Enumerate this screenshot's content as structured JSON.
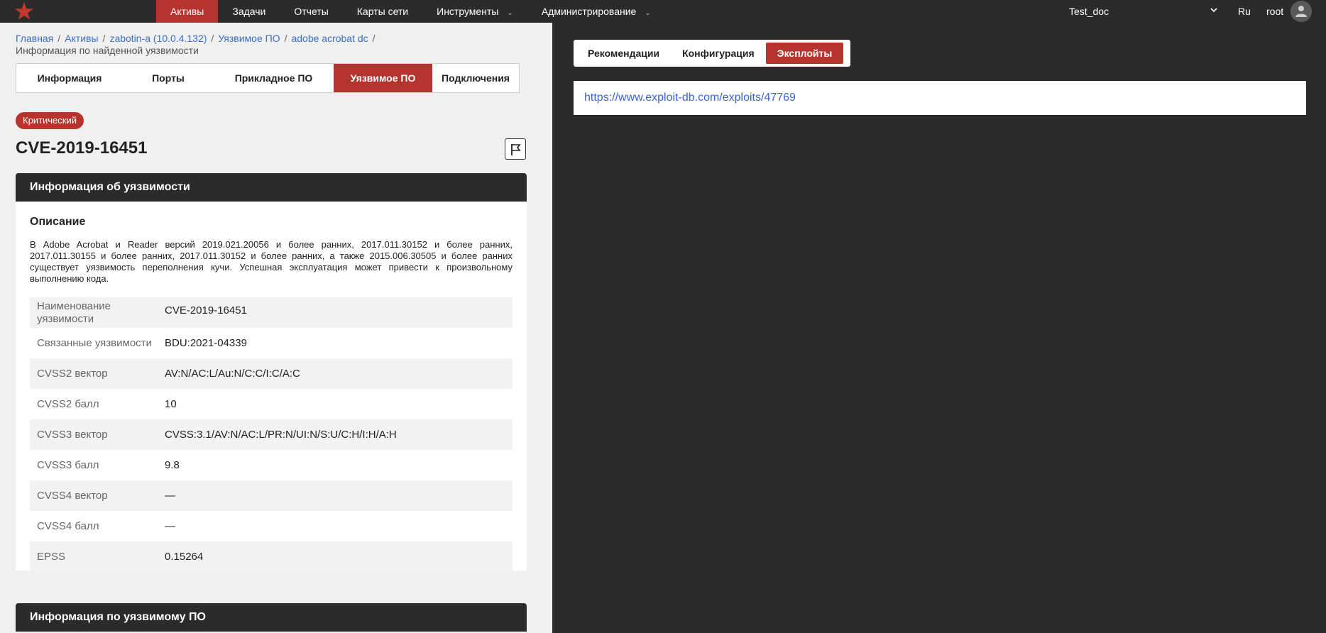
{
  "topbar": {
    "nav": [
      {
        "label": "Активы",
        "active": true,
        "dropdown": false
      },
      {
        "label": "Задачи",
        "active": false,
        "dropdown": false
      },
      {
        "label": "Отчеты",
        "active": false,
        "dropdown": false
      },
      {
        "label": "Карты сети",
        "active": false,
        "dropdown": false
      },
      {
        "label": "Инструменты",
        "active": false,
        "dropdown": true
      },
      {
        "label": "Администрирование",
        "active": false,
        "dropdown": true
      }
    ],
    "chevron": "⌄",
    "doc_select": "Test_doc",
    "lang": "Ru",
    "user": "root"
  },
  "breadcrumb": {
    "items": [
      "Главная",
      "Активы",
      "zabotin-a (10.0.4.132)",
      "Уязвимое ПО",
      "adobe acrobat dc"
    ],
    "separator": "/",
    "current": "Информация по найденной уязвимости"
  },
  "tabs": [
    {
      "label": "Информация",
      "active": false
    },
    {
      "label": "Порты",
      "active": false
    },
    {
      "label": "Прикладное ПО",
      "active": false
    },
    {
      "label": "Уязвимое ПО",
      "active": true
    },
    {
      "label": "Подключения",
      "active": false
    }
  ],
  "severity": "Критический",
  "cve_id": "CVE-2019-16451",
  "vuln_card": {
    "header": "Информация об уязвимости",
    "desc_title": "Описание",
    "description": "В Adobe Acrobat и Reader версий 2019.021.20056 и более ранних, 2017.011.30152 и более ранних, 2017.011.30155 и более ранних, 2017.011.30152 и более ранних, а также 2015.006.30505 и более ранних существует уязвимость переполнения кучи. Успешная эксплуатация может привести к произвольному выполнению кода.",
    "rows": [
      {
        "key": "Наименование уязвимости",
        "value": "CVE-2019-16451"
      },
      {
        "key": "Связанные уязвимости",
        "value": "BDU:2021-04339"
      },
      {
        "key": "CVSS2 вектор",
        "value": "AV:N/AC:L/Au:N/C:C/I:C/A:C"
      },
      {
        "key": "CVSS2 балл",
        "value": "10"
      },
      {
        "key": "CVSS3 вектор",
        "value": "CVSS:3.1/AV:N/AC:L/PR:N/UI:N/S:U/C:H/I:H/A:H"
      },
      {
        "key": "CVSS3 балл",
        "value": "9.8"
      },
      {
        "key": "CVSS4 вектор",
        "value": "—"
      },
      {
        "key": "CVSS4 балл",
        "value": "—"
      },
      {
        "key": "EPSS",
        "value": "0.15264"
      }
    ]
  },
  "software_card": {
    "header": "Информация по уязвимому ПО"
  },
  "right_tabs": [
    {
      "label": "Рекомендации",
      "active": false
    },
    {
      "label": "Конфигурация",
      "active": false
    },
    {
      "label": "Эксплойты",
      "active": true
    }
  ],
  "exploit_link": "https://www.exploit-db.com/exploits/47769",
  "colors": {
    "accent": "#b5352e",
    "dark": "#2b2b2b",
    "link": "#3a62d8"
  }
}
